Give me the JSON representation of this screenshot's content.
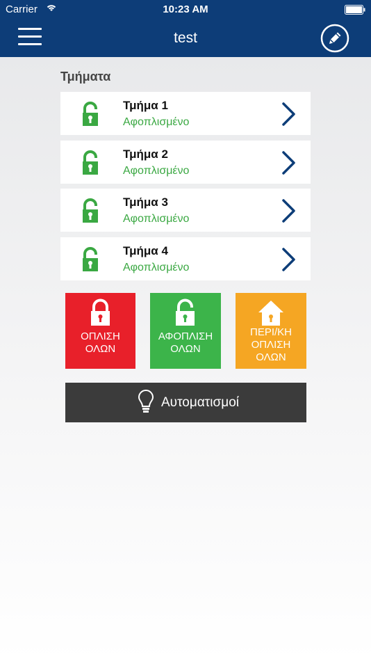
{
  "status_bar": {
    "carrier": "Carrier",
    "time": "10:23 AM"
  },
  "nav": {
    "title": "test",
    "menu_icon": "hamburger-menu-icon",
    "edit_icon": "pencil-edit-icon"
  },
  "section": {
    "title": "Τμήματα"
  },
  "partitions": [
    {
      "name": "Τμήμα 1",
      "status": "Αφοπλισμένο"
    },
    {
      "name": "Τμήμα 2",
      "status": "Αφοπλισμένο"
    },
    {
      "name": "Τμήμα 3",
      "status": "Αφοπλισμένο"
    },
    {
      "name": "Τμήμα 4",
      "status": "Αφοπλισμένο"
    }
  ],
  "actions": {
    "arm_all": {
      "line1": "ΟΠΛΙΣΗ",
      "line2": "ΟΛΩΝ",
      "color": "#e8202a"
    },
    "disarm_all": {
      "line1": "ΑΦΟΠΛΙΣΗ",
      "line2": "ΟΛΩΝ",
      "color": "#3cb44a"
    },
    "perimeter": {
      "line1": "ΠΕΡΙ/ΚΗ",
      "line2": "ΟΠΛΙΣΗ",
      "line3": "ΟΛΩΝ",
      "color": "#f5a623"
    }
  },
  "automations": {
    "label": "Αυτοματισμοί",
    "icon": "lightbulb-icon"
  },
  "colors": {
    "nav": "#0d3d78",
    "unlocked": "#3aa842",
    "chevron": "#0d3d78"
  }
}
